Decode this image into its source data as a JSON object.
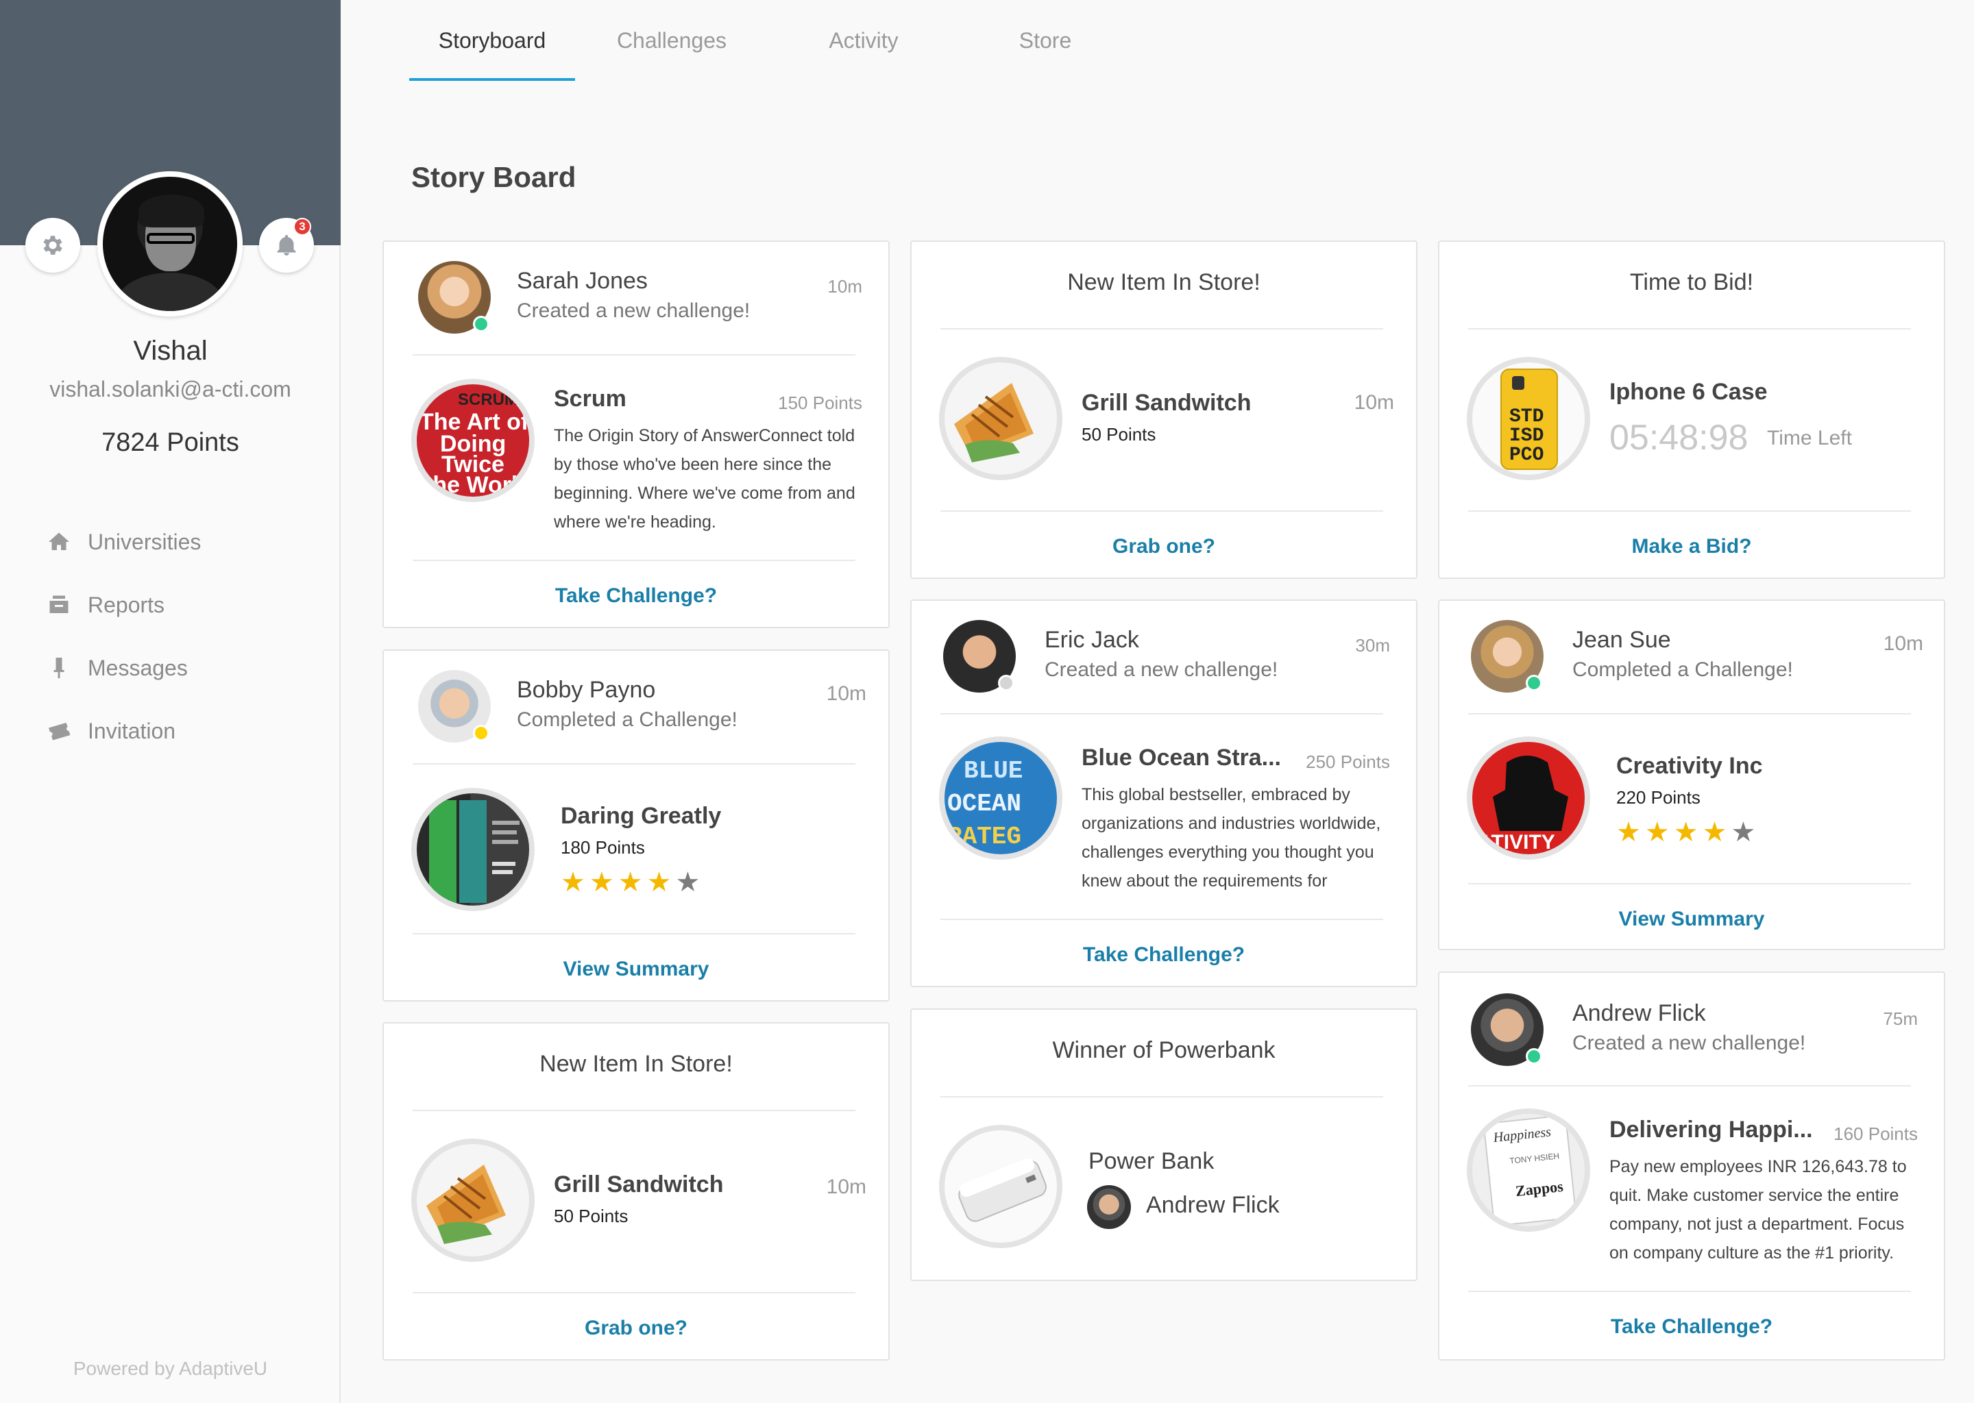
{
  "sidebar": {
    "user_name": "Vishal",
    "user_email": "vishal.solanki@a-cti.com",
    "points": "7824 Points",
    "notification_count": "3",
    "nav": [
      {
        "label": "Universities",
        "icon": "home-icon"
      },
      {
        "label": "Reports",
        "icon": "reports-icon"
      },
      {
        "label": "Messages",
        "icon": "messages-icon"
      },
      {
        "label": "Invitation",
        "icon": "ticket-icon"
      }
    ],
    "powered_by": "Powered by AdaptiveU"
  },
  "tabs": [
    {
      "label": "Storyboard",
      "active": true
    },
    {
      "label": "Challenges",
      "active": false
    },
    {
      "label": "Activity",
      "active": false
    },
    {
      "label": "Store",
      "active": false
    }
  ],
  "page_title": "Story Board",
  "cards": {
    "c1": {
      "person": "Sarah Jones",
      "action": "Created a new challenge!",
      "time": "10m",
      "status": "online",
      "item": "Scrum",
      "points": "150 Points",
      "desc": [
        "The Origin Story of AnswerConnect told",
        "by those who've been here since the",
        "beginning. Where we've come from and",
        "where we're heading."
      ],
      "thumb_text": [
        "SCRUM",
        "The Art of",
        "Doing",
        "Twice",
        "the Work"
      ],
      "link": "Take Challenge?"
    },
    "c2": {
      "person": "Bobby Payno",
      "action": "Completed a Challenge!",
      "time": "10m",
      "status": "away",
      "item": "Daring Greatly",
      "points": "180 Points",
      "rating": 4,
      "rating_max": 5,
      "link": "View Summary"
    },
    "c3": {
      "title": "New Item In Store!",
      "item": "Grill Sandwitch",
      "points": "50 Points",
      "time": "10m",
      "link": "Grab one?"
    },
    "c4": {
      "title": "New Item In Store!",
      "item": "Grill Sandwitch",
      "points": "50 Points",
      "time": "10m",
      "link": "Grab one?"
    },
    "c5": {
      "person": "Eric Jack",
      "action": "Created a new challenge!",
      "time": "30m",
      "status": "offline",
      "item": "Blue Ocean Stra...",
      "points": "250 Points",
      "desc": [
        "This global bestseller, embraced by",
        "organizations and industries worldwide,",
        "challenges everything you thought you",
        "knew about the requirements for"
      ],
      "thumb_text": [
        "BLUE",
        "OCEAN",
        "RATEG"
      ],
      "link": "Take Challenge?"
    },
    "c6": {
      "title": "Winner of Powerbank",
      "item": "Power Bank",
      "winner": "Andrew Flick"
    },
    "c7": {
      "title": "Time to Bid!",
      "item": "Iphone 6 Case",
      "countdown": "05:48:98",
      "time_left": "Time Left",
      "thumb_text": [
        "STD",
        "ISD",
        "PCO"
      ],
      "link": "Make a Bid?"
    },
    "c8": {
      "person": "Jean Sue",
      "action": "Completed a Challenge!",
      "time": "10m",
      "status": "online",
      "item": "Creativity Inc",
      "points": "220 Points",
      "rating": 4,
      "rating_max": 5,
      "thumb_text": "ATIVITY",
      "link": "View Summary"
    },
    "c9": {
      "person": "Andrew Flick",
      "action": "Created a new challenge!",
      "time": "75m",
      "status": "online",
      "item": "Delivering Happi...",
      "points": "160 Points",
      "desc": [
        "Pay new employees INR 126,643.78 to",
        "quit. Make customer service the entire",
        "company, not just a department. Focus",
        "on company culture as the #1 priority."
      ],
      "thumb_text": [
        "Happiness",
        "TONY HSIEH",
        "Zappos"
      ],
      "link": "Take Challenge?"
    }
  },
  "colors": {
    "banner": "#53606b",
    "accent": "#1f9fd8",
    "link": "#1a7fa8",
    "star": "#f5b800",
    "online": "#2ecc8f",
    "away": "#ffd400",
    "badge": "#e53935"
  }
}
